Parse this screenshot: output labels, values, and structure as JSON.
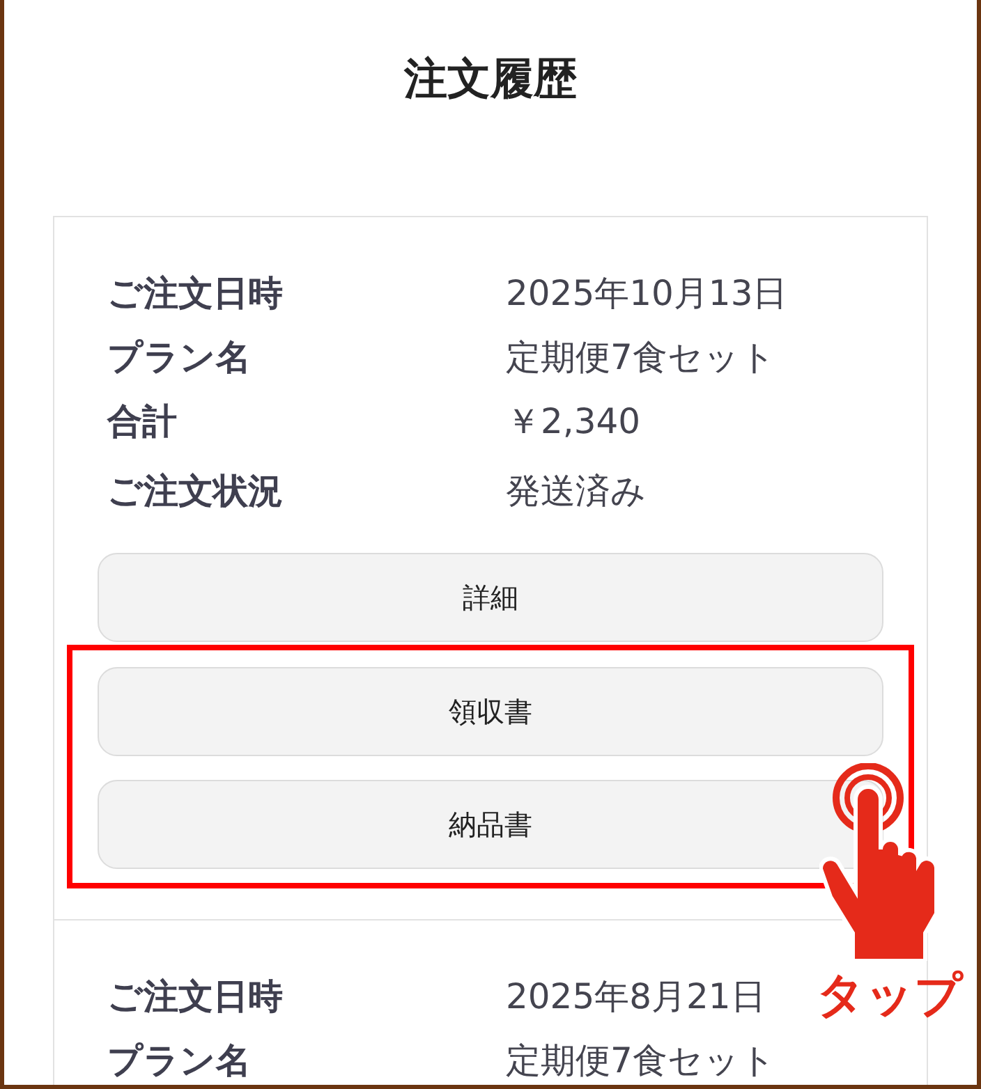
{
  "title": "注文履歴",
  "orders": [
    {
      "rows": [
        {
          "label": "ご注文日時",
          "value": "2025年10月13日"
        },
        {
          "label": "プラン名",
          "value": "定期便7食セット"
        },
        {
          "label": "合計",
          "value": "￥2,340"
        },
        {
          "label": "ご注文状況",
          "value": "発送済み"
        }
      ],
      "buttons": [
        {
          "label": "詳細",
          "highlighted": false
        },
        {
          "label": "領収書",
          "highlighted": true
        },
        {
          "label": "納品書",
          "highlighted": true
        }
      ]
    },
    {
      "rows": [
        {
          "label": "ご注文日時",
          "value": "2025年8月21日"
        },
        {
          "label": "プラン名",
          "value": "定期便7食セット"
        }
      ]
    }
  ],
  "callout": {
    "text": "タップ"
  }
}
